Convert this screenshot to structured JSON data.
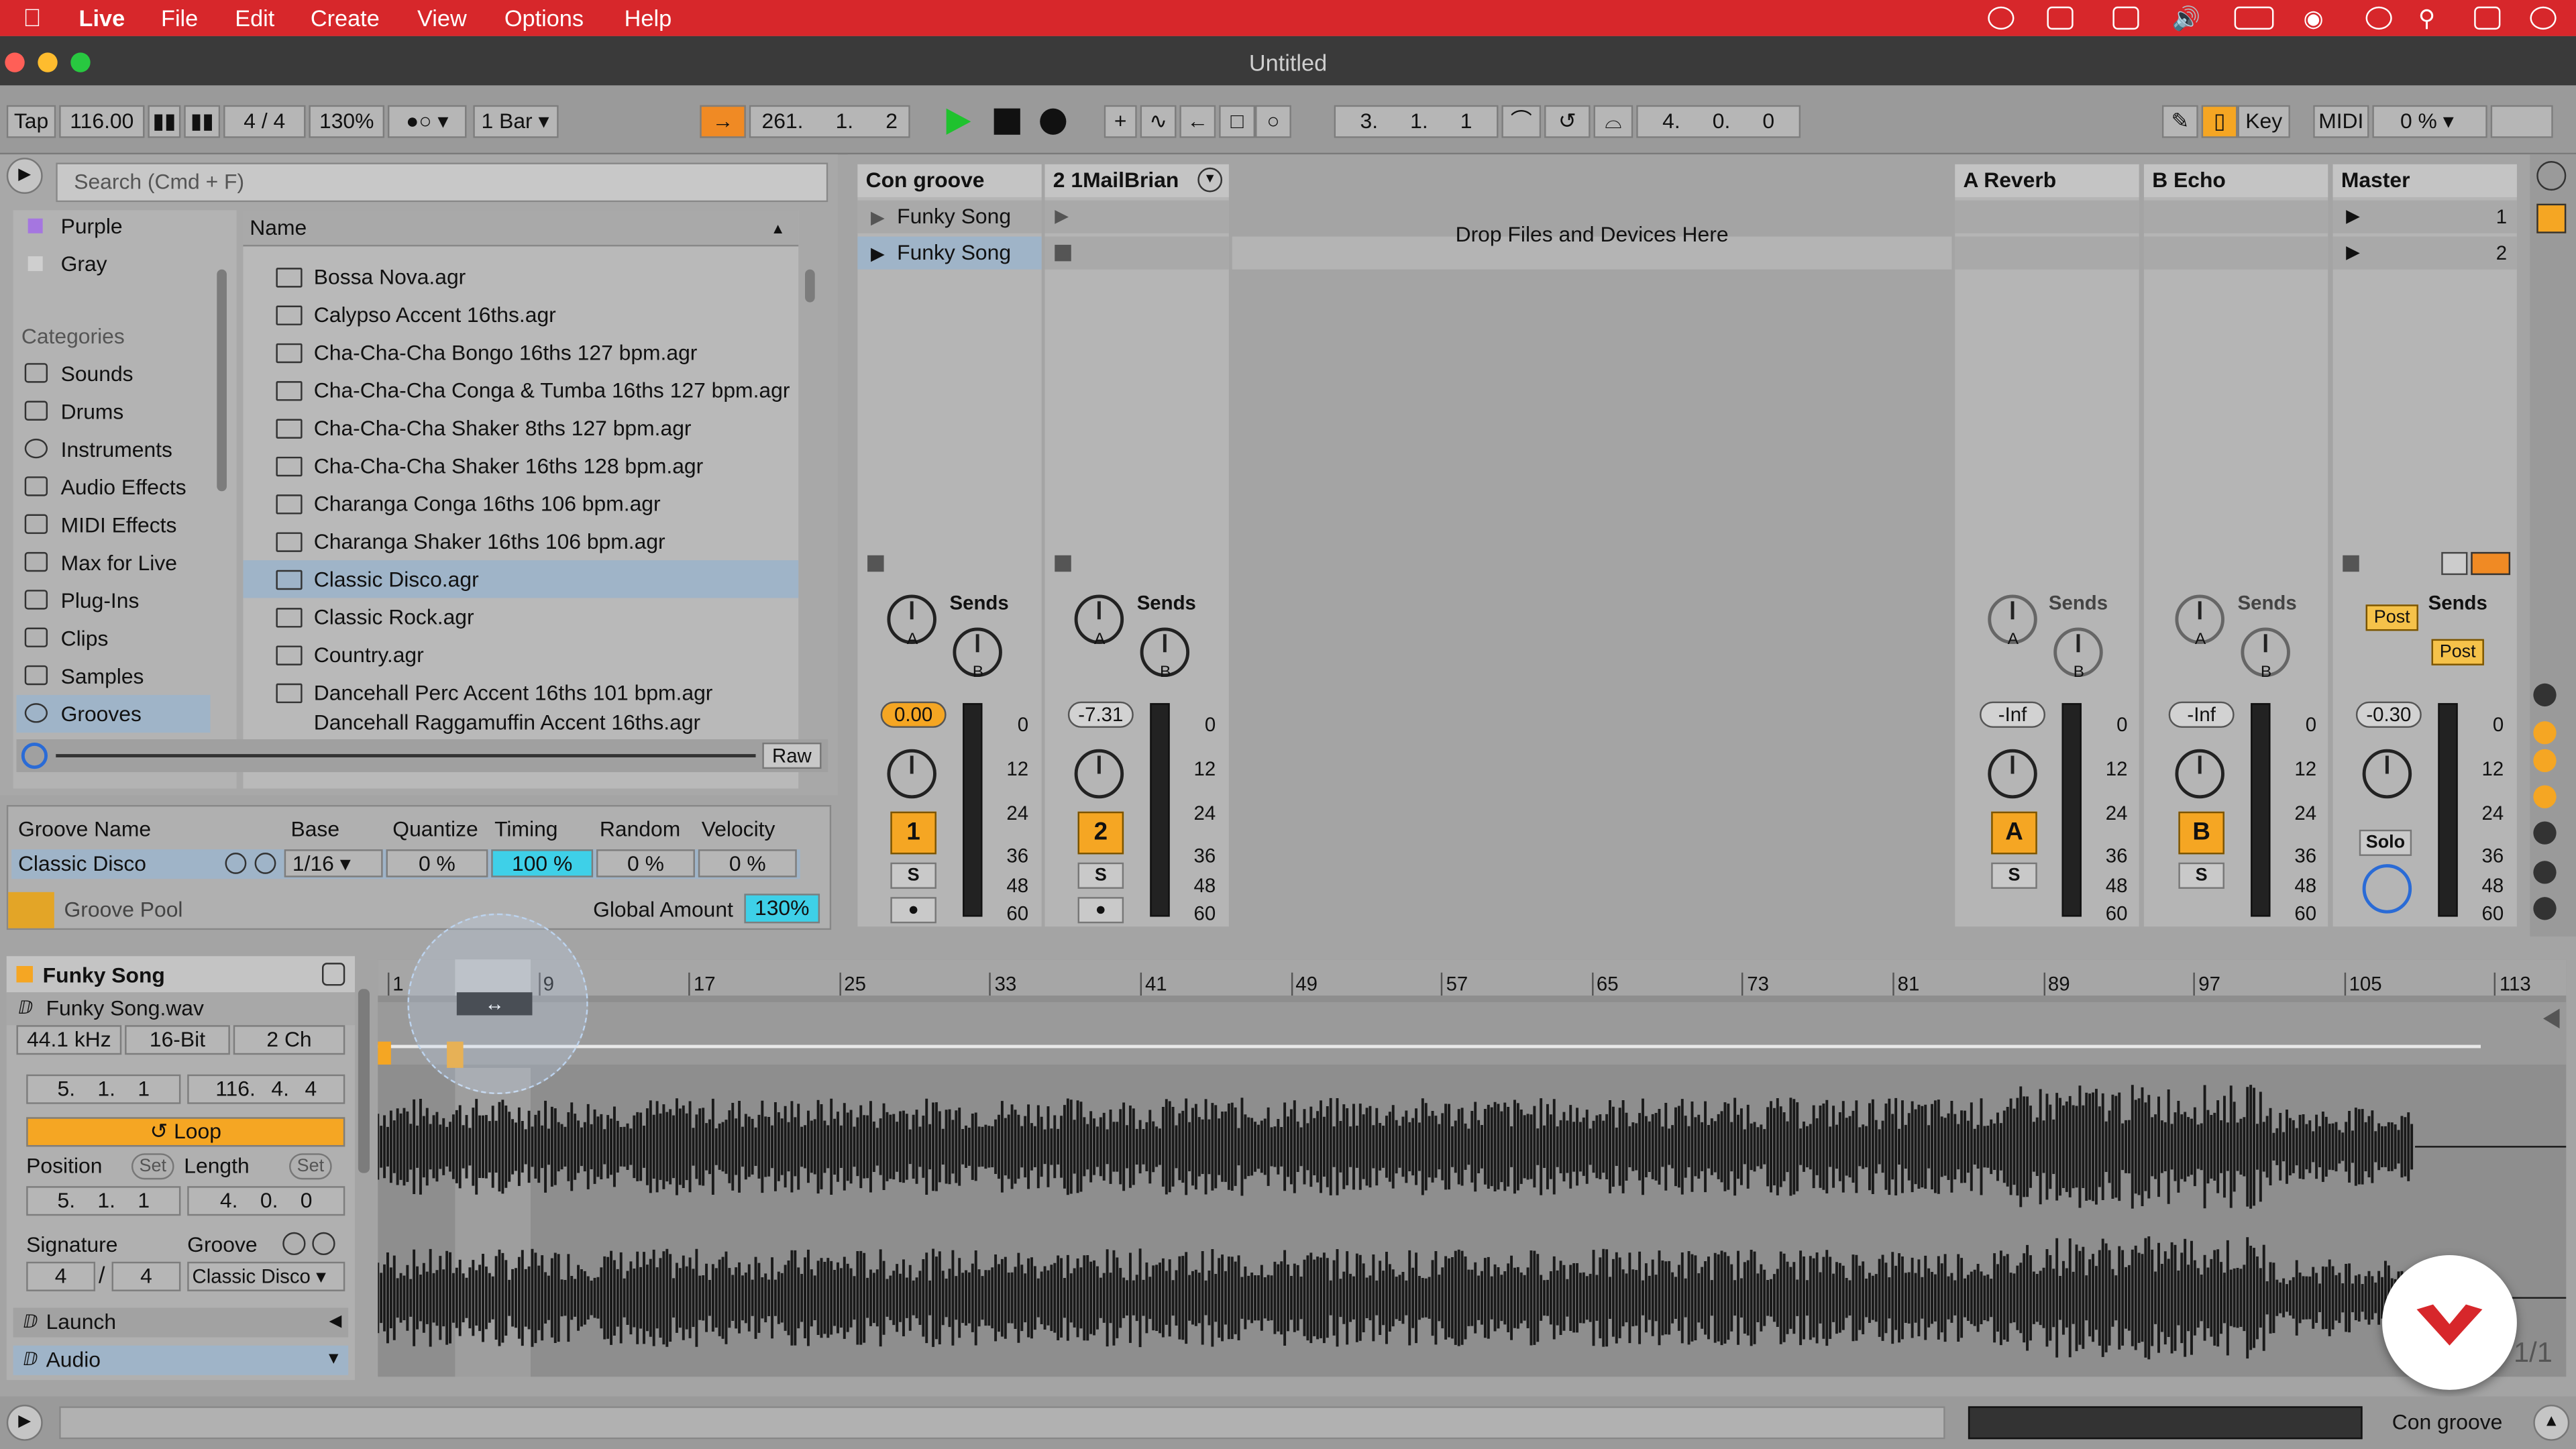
{
  "menubar": {
    "app": "Live",
    "items": [
      "File",
      "Edit",
      "Create",
      "View",
      "Options",
      "Help"
    ]
  },
  "window": {
    "title": "Untitled"
  },
  "transport": {
    "tap": "Tap",
    "tempo": "116.00",
    "signature": "4 / 4",
    "zoom": "130%",
    "quantize": "1 Bar",
    "position": [
      "261",
      "1",
      "2"
    ],
    "loop_start": [
      "3",
      "1",
      "1"
    ],
    "loop_length": [
      "4",
      "0",
      "0"
    ],
    "key": "Key",
    "midi": "MIDI",
    "cpu": "0 %"
  },
  "browser": {
    "search_placeholder": "Search (Cmd + F)",
    "collections": [
      "Purple",
      "Gray"
    ],
    "categories_title": "Categories",
    "categories": [
      "Sounds",
      "Drums",
      "Instruments",
      "Audio Effects",
      "MIDI Effects",
      "Max for Live",
      "Plug-Ins",
      "Clips",
      "Samples",
      "Grooves"
    ],
    "name_header": "Name",
    "files": [
      "Bossa Nova.agr",
      "Calypso Accent 16ths.agr",
      "Cha-Cha-Cha Bongo 16ths 127 bpm.agr",
      "Cha-Cha-Cha Conga & Tumba 16ths 127 bpm.agr",
      "Cha-Cha-Cha Shaker 8ths 127 bpm.agr",
      "Cha-Cha-Cha Shaker 16ths 128 bpm.agr",
      "Charanga Conga 16ths 106 bpm.agr",
      "Charanga Shaker 16ths 106 bpm.agr",
      "Classic Disco.agr",
      "Classic Rock.agr",
      "Country.agr",
      "Dancehall Perc Accent 16ths 101 bpm.agr",
      "Dancehall Raggamuffin Accent 16ths.agr"
    ],
    "raw": "Raw"
  },
  "groove": {
    "headers": [
      "Groove Name",
      "Base",
      "Quantize",
      "Timing",
      "Random",
      "Velocity"
    ],
    "name": "Classic Disco",
    "base": "1/16",
    "quantize": "0 %",
    "timing": "100 %",
    "random": "0 %",
    "velocity": "0 %",
    "pool_label": "Groove Pool",
    "global_label": "Global Amount",
    "global_value": "130%"
  },
  "session": {
    "tracks": [
      {
        "name": "Con groove",
        "clip": "Funky Song",
        "clip2": "Funky Song",
        "volume": "0.00",
        "number": "1"
      },
      {
        "name": "2 1MailBrian",
        "volume": "-7.31",
        "number": "2"
      }
    ],
    "drop_text": "Drop Files and Devices Here",
    "returns": [
      {
        "name": "A Reverb",
        "volume": "-Inf",
        "letter": "A"
      },
      {
        "name": "B Echo",
        "volume": "-Inf",
        "letter": "B"
      }
    ],
    "master": {
      "name": "Master",
      "volume": "-0.30",
      "scenes": [
        "1",
        "2"
      ],
      "solo": "Solo",
      "post": "Post"
    },
    "sends": "Sends",
    "solo_btn": "S",
    "knob_a": "A",
    "knob_b": "B",
    "meter_scale": [
      "0",
      "12",
      "24",
      "36",
      "48",
      "60"
    ]
  },
  "clipview": {
    "title": "Funky Song",
    "file": "Funky Song.wav",
    "rate": "44.1 kHz",
    "depth": "16-Bit",
    "channels": "2 Ch",
    "start": [
      "5",
      "1",
      "1"
    ],
    "end": [
      "116",
      "4",
      "4"
    ],
    "loop": "Loop",
    "position_label": "Position",
    "length_label": "Length",
    "set": "Set",
    "position": [
      "5",
      "1",
      "1"
    ],
    "length": [
      "4",
      "0",
      "0"
    ],
    "signature_label": "Signature",
    "groove_label": "Groove",
    "sig_num": "4",
    "sig_den": "4",
    "groove": "Classic Disco",
    "launch": "Launch",
    "audio": "Audio",
    "bars": [
      "1",
      "9",
      "17",
      "25",
      "33",
      "41",
      "49",
      "57",
      "65",
      "73",
      "81",
      "89",
      "97",
      "105",
      "113"
    ],
    "page": "1/1"
  },
  "statusbar": {
    "track": "Con groove"
  }
}
